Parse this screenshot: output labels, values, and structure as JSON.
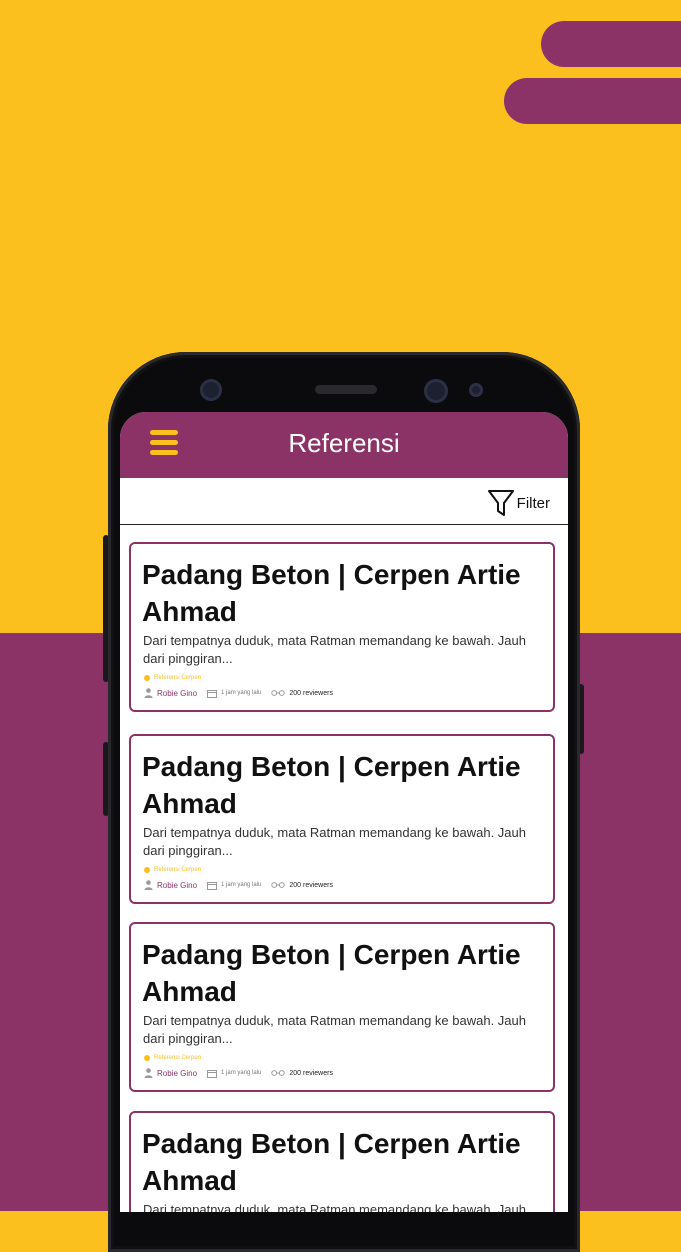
{
  "app": {
    "title": "Referensi"
  },
  "filter": {
    "label": "Filter"
  },
  "colors": {
    "primary": "#8B3366",
    "accent": "#FBBF1E"
  },
  "icons": [
    "menu-icon",
    "filter-icon",
    "category-dot-icon",
    "user-icon",
    "calendar-icon",
    "glasses-icon"
  ],
  "articles": [
    {
      "title": "Padang Beton | Cerpen Artie Ahmad",
      "excerpt": "Dari tempatnya duduk, mata Ratman memandang ke bawah. Jauh dari pinggiran...",
      "category": "Referensi Cerpen",
      "author": "Robie Gino",
      "time": "1 jam yang lalu",
      "reviewers": "200 reviewers"
    },
    {
      "title": "Padang Beton | Cerpen Artie Ahmad",
      "excerpt": "Dari tempatnya duduk, mata Ratman memandang ke bawah. Jauh dari pinggiran...",
      "category": "Referensi Cerpen",
      "author": "Robie Gino",
      "time": "1 jam yang lalu",
      "reviewers": "200 reviewers"
    },
    {
      "title": "Padang Beton | Cerpen Artie Ahmad",
      "excerpt": "Dari tempatnya duduk, mata Ratman memandang ke bawah. Jauh dari pinggiran...",
      "category": "Referensi Cerpen",
      "author": "Robie Gino",
      "time": "1 jam yang lalu",
      "reviewers": "200 reviewers"
    },
    {
      "title": "Padang Beton | Cerpen Artie Ahmad",
      "excerpt": "Dari tempatnya duduk, mata Ratman memandang ke bawah. Jauh dari pinggiran..."
    }
  ]
}
